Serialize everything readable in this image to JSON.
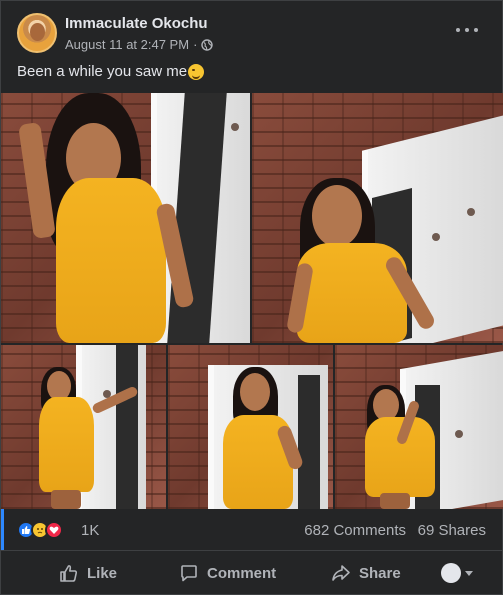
{
  "post": {
    "author": "Immaculate Okochu",
    "timestamp": "August 11 at 2:47 PM",
    "separator": "·",
    "audience_icon": "globe-icon",
    "caption": "Been a while you saw me",
    "caption_emoji": "winking-face-emoji"
  },
  "reactions": {
    "types": [
      "like",
      "sad",
      "love"
    ],
    "count": "1K",
    "comments": "682 Comments",
    "shares": "69 Shares"
  },
  "actions": {
    "like_label": "Like",
    "comment_label": "Comment",
    "share_label": "Share"
  },
  "colors": {
    "background": "#242526",
    "text_primary": "#e4e6eb",
    "text_secondary": "#b0b3b8",
    "like_blue": "#2078f4",
    "love_red": "#f02849",
    "sad_yellow": "#f7c531",
    "dress_yellow": "#f4b321"
  }
}
